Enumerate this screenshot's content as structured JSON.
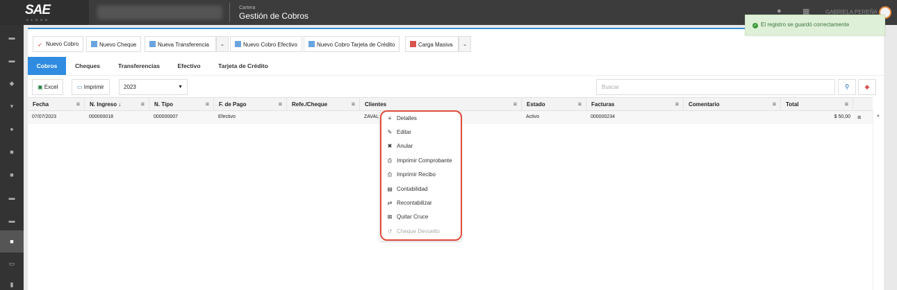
{
  "header": {
    "logo": "SAE",
    "logo_sub": "CLOUD",
    "section_small": "Cartera",
    "section_title": "Gestión de Cobros",
    "user_name": "GABRIELA PEREÑA"
  },
  "toast": {
    "text": "El registro se guardó correctamente"
  },
  "toolbar": {
    "buttons": [
      "Nuevo Cobro",
      "Nuevo Cheque",
      "Nueva Transferencia",
      "Nuevo Cobro Efectivo",
      "Nuevo Cobro Tarjeta de Crédito",
      "Carga Masiva"
    ]
  },
  "tabs": [
    "Cobros",
    "Cheques",
    "Transferencias",
    "Efectivo",
    "Tarjeta de Crédito"
  ],
  "tools": {
    "excel": "Excel",
    "print": "Imprimir",
    "year": "2023",
    "search_placeholder": "Buscar"
  },
  "table": {
    "columns": [
      "Fecha",
      "N. Ingreso ↓",
      "N. Tipo",
      "F. de Pago",
      "Refe./Cheque",
      "Clientes",
      "Estado",
      "Facturas",
      "Comentario",
      "Total"
    ],
    "rows": [
      {
        "fecha": "07/07/2023",
        "ingreso": "000000018",
        "tipo": "000000007",
        "pago": "Efectivo",
        "refe": "",
        "cliente": "ZAVAL",
        "estado": "Activo",
        "facturas": "000000234",
        "comentario": "",
        "total": "$ 50,00"
      }
    ]
  },
  "context_menu": {
    "items": [
      {
        "label": "Detalles",
        "icon": "list-icon"
      },
      {
        "label": "Editar",
        "icon": "pencil-icon"
      },
      {
        "label": "Anular",
        "icon": "x-icon"
      },
      {
        "label": "Imprimir Comprobante",
        "icon": "printer-icon"
      },
      {
        "label": "Imprimir Recibo",
        "icon": "printer-icon"
      },
      {
        "label": "Contabilidad",
        "icon": "book-icon"
      },
      {
        "label": "Recontabilizar",
        "icon": "retweet-icon"
      },
      {
        "label": "Quitar Cruce",
        "icon": "close-box-icon"
      },
      {
        "label": "Cheque Devuelto",
        "icon": "undo-icon",
        "disabled": true
      }
    ]
  },
  "colors": {
    "primary": "#2f8ce0",
    "topbar": "#3c3c3c",
    "sidebar": "#333333",
    "highlight": "#e04b3a",
    "toast_bg": "#dff0d8",
    "toast_text": "#3c763d"
  }
}
